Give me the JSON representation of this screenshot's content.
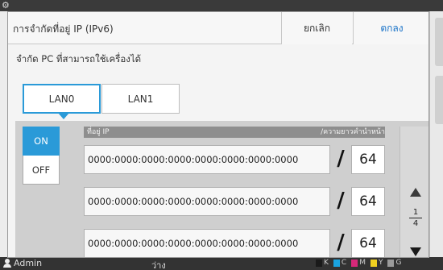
{
  "background": {
    "status_user": "Admin",
    "status_state": "ว่าง",
    "inks": [
      {
        "label": "K",
        "color": "#1a1a1a"
      },
      {
        "label": "C",
        "color": "#1aa3e0"
      },
      {
        "label": "M",
        "color": "#d6287a"
      },
      {
        "label": "Y",
        "color": "#f0d020"
      },
      {
        "label": "G",
        "color": "#9a9a9a"
      }
    ]
  },
  "dialog": {
    "title": "การจำกัดที่อยู่ IP (IPv6)",
    "cancel_label": "ยกเลิก",
    "ok_label": "ตกลง",
    "subtitle": "จำกัด PC ที่สามารถใช้เครื่องได้"
  },
  "tabs": [
    {
      "label": "LAN0",
      "active": true
    },
    {
      "label": "LAN1",
      "active": false
    }
  ],
  "toggle": {
    "on_label": "ON",
    "off_label": "OFF",
    "selected": "ON"
  },
  "list": {
    "header_ip": "ที่อยู่ IP",
    "header_prefix": "/ความยาวคำนำหน้า",
    "rows": [
      {
        "address": "0000:0000:0000:0000:0000:0000:0000:0000",
        "separator": "/",
        "prefix": "64"
      },
      {
        "address": "0000:0000:0000:0000:0000:0000:0000:0000",
        "separator": "/",
        "prefix": "64"
      },
      {
        "address": "0000:0000:0000:0000:0000:0000:0000:0000",
        "separator": "/",
        "prefix": "64"
      }
    ]
  },
  "pager": {
    "current": "1",
    "total": "4"
  },
  "colors": {
    "accent": "#2a9ad8",
    "ok_text": "#1a73c8"
  }
}
